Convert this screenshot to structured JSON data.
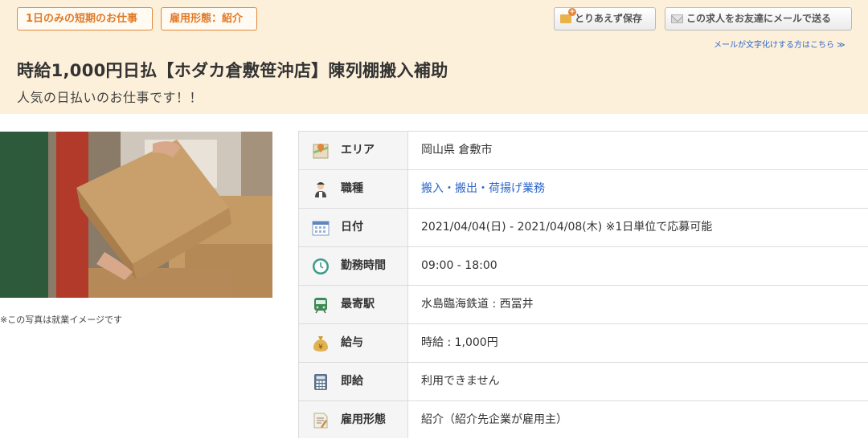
{
  "tags": [
    "1日のみの短期のお仕事",
    "雇用形態：紹介"
  ],
  "buttons": {
    "save": "とりあえず保存",
    "mail": "この求人をお友達にメールで送る"
  },
  "mail_note": "メールが文字化けする方はこちら ≫",
  "job": {
    "title": "時給1,000円日払【ホダカ倉敷笹沖店】陳列棚搬入補助",
    "subtitle": "人気の日払いのお仕事です！！"
  },
  "photo_caption": "※この写真は就業イメージです",
  "details": [
    {
      "icon": "map-icon",
      "label": "エリア",
      "value": "岡山県 倉敷市",
      "link": false
    },
    {
      "icon": "worker-icon",
      "label": "職種",
      "value": "搬入・搬出・荷揚げ業務",
      "link": true
    },
    {
      "icon": "calendar-icon",
      "label": "日付",
      "value": "2021/04/04(日) - 2021/04/08(木) ※1日単位で応募可能",
      "link": false
    },
    {
      "icon": "clock-icon",
      "label": "勤務時間",
      "value": "09:00 - 18:00",
      "link": false
    },
    {
      "icon": "train-icon",
      "label": "最寄駅",
      "value": "水島臨海鉄道 : 西冨井",
      "link": false
    },
    {
      "icon": "money-bag-icon",
      "label": "給与",
      "value": "時給 : 1,000円",
      "link": false
    },
    {
      "icon": "calculator-icon",
      "label": "即給",
      "value": "利用できません",
      "link": false
    },
    {
      "icon": "contract-icon",
      "label": "雇用形態",
      "value": "紹介（紹介先企業が雇用主）",
      "link": false
    }
  ],
  "colors": {
    "header_bg": "#fdf0da",
    "tag_accent": "#e0873a",
    "link": "#2b66c9"
  }
}
